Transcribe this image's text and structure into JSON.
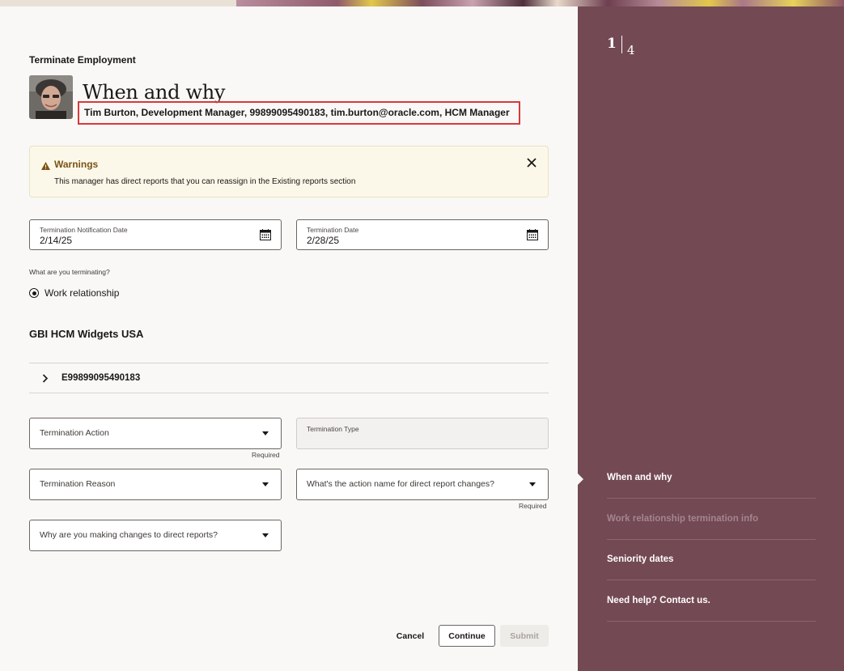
{
  "page": {
    "header": "Terminate Employment",
    "title": "When and why",
    "person_summary": "Tim Burton, Development Manager, 99899095490183, tim.burton@oracle.com, HCM Manager"
  },
  "warning": {
    "title": "Warnings",
    "message": "This manager has direct reports that you can reassign in the Existing reports section"
  },
  "dates": {
    "notification_label": "Termination Notification Date",
    "notification_value": "2/14/25",
    "termination_label": "Termination Date",
    "termination_value": "2/28/25"
  },
  "terminating": {
    "question": "What are you terminating?",
    "option": "Work relationship"
  },
  "work_relationship": {
    "org": "GBI HCM Widgets USA",
    "id": "E99899095490183"
  },
  "form": {
    "termination_action": "Termination Action",
    "termination_type": "Termination Type",
    "termination_reason": "Termination Reason",
    "direct_report_action": "What's the action name for direct report changes?",
    "direct_report_reason": "Why are you making changes to direct reports?",
    "required": "Required"
  },
  "buttons": {
    "cancel": "Cancel",
    "continue": "Continue",
    "submit": "Submit"
  },
  "progress": {
    "current": "1",
    "total": "4"
  },
  "nav": [
    {
      "label": "When and why",
      "state": "current"
    },
    {
      "label": "Work relationship termination info",
      "state": "disabled"
    },
    {
      "label": "Seniority dates",
      "state": "enabled"
    },
    {
      "label": "Need help? Contact us.",
      "state": "enabled"
    }
  ],
  "colors": {
    "side_panel": "#734953",
    "warning_bg": "#fcf8e9",
    "warning_title": "#7a5316",
    "highlight_border": "#d9383c"
  },
  "icons": {
    "warning": "warning-triangle-icon",
    "close": "close-icon",
    "calendar": "calendar-icon",
    "expand": "chevron-right-icon",
    "dropdown": "caret-down-icon"
  }
}
